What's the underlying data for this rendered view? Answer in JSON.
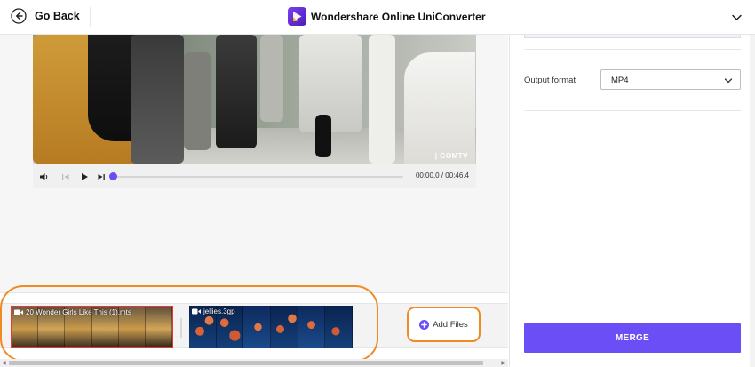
{
  "header": {
    "back_label": "Go Back",
    "brand_name": "Wondershare Online UniConverter",
    "back_icon": "arrow-left-circle-icon",
    "brand_icon": "uniconverter-logo-icon",
    "menu_icon": "chevron-down-icon"
  },
  "player": {
    "watermark": "| GOMTV",
    "time_display": "00:00.0 / 00:46.4",
    "progress": 0.0,
    "controls": [
      "volume-icon",
      "previous-frame-icon",
      "play-icon",
      "next-frame-icon"
    ]
  },
  "timeline": {
    "clips": [
      {
        "name": "20 Wonder Girls Like This (1).mts",
        "selected": true
      },
      {
        "name": "jellies.3gp",
        "selected": false
      }
    ],
    "add_files_label": "Add Files"
  },
  "settings": {
    "output_format_label": "Output format",
    "output_format_value": "MP4",
    "merge_label": "MERGE"
  },
  "colors": {
    "accent": "#6b4ef5",
    "highlight": "#f08a24",
    "selected_clip_border": "#e53935"
  }
}
